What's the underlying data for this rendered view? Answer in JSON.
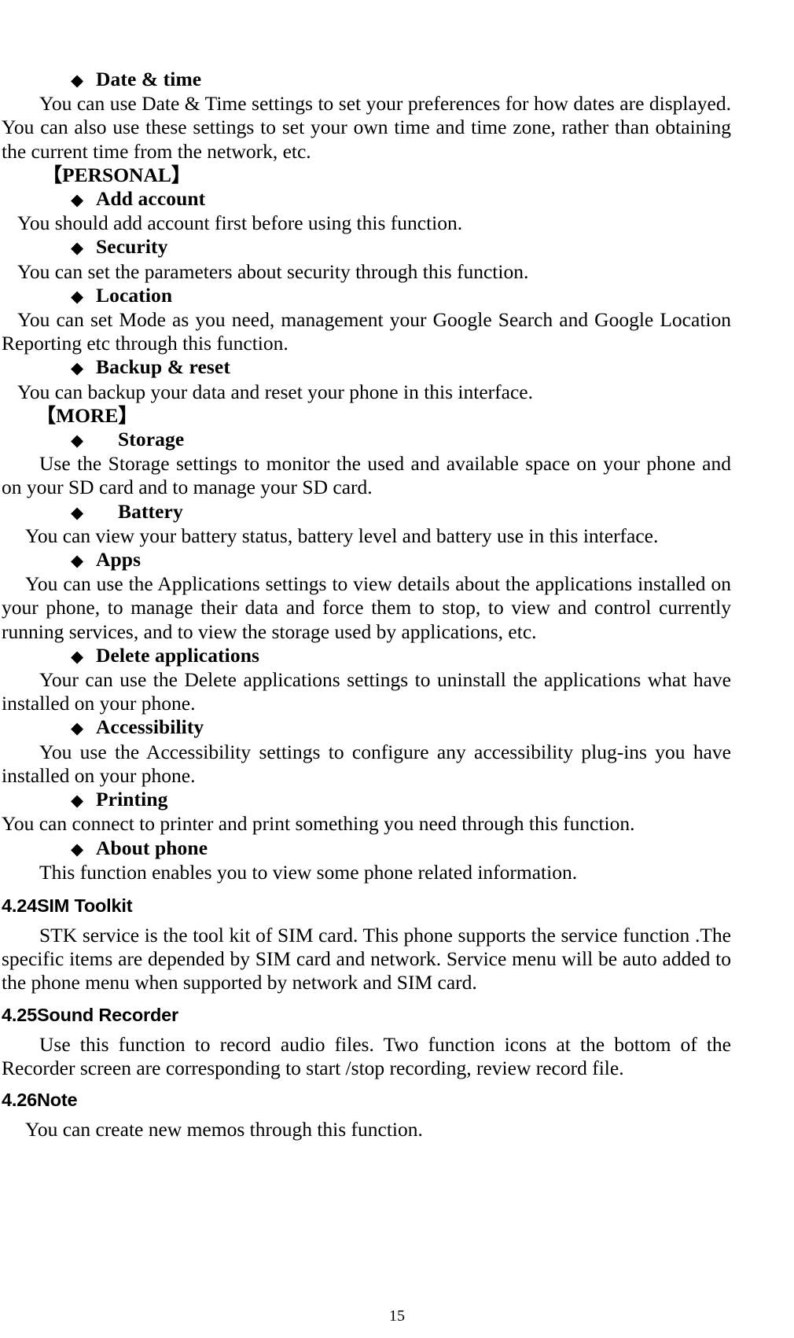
{
  "document": {
    "page_number": "15",
    "bullet_glyph": "◆",
    "bracket_open": "【",
    "bracket_close": "】"
  },
  "blocks": {
    "date_time": {
      "bullet": "Date & time",
      "body": "You can use Date & Time settings to set your preferences for how dates are displayed. You can also use these settings to set your own time and time zone, rather than obtaining the current time from the network, etc."
    },
    "personal_group": {
      "label": "PERSONAL"
    },
    "add_account": {
      "bullet": "Add account",
      "body": "You should add account first before using this function."
    },
    "security": {
      "bullet": "Security",
      "body": "You can set the parameters about security through this function."
    },
    "location": {
      "bullet": "Location",
      "body": "You can set Mode as you need, management your Google Search and Google Location Reporting etc through this function."
    },
    "backup_reset": {
      "bullet": "Backup & reset",
      "body": "You can backup your data and reset your phone in this interface."
    },
    "more_group": {
      "label": "MORE"
    },
    "storage": {
      "bullet": "Storage",
      "body": "Use the Storage settings to monitor the used and available space on your phone and on your SD card and to manage your SD card."
    },
    "battery": {
      "bullet": "Battery",
      "body": "You can view your battery status, battery level and battery use in this interface."
    },
    "apps": {
      "bullet": "Apps",
      "body": "You can use the Applications settings to view details about the applications installed on your phone, to manage their data and force them to stop, to view and control currently running services, and to view the storage used by applications, etc."
    },
    "delete_applications": {
      "bullet": "Delete applications",
      "body": "Your can use the Delete applications settings to uninstall the applications what have installed on your phone."
    },
    "accessibility": {
      "bullet": "Accessibility",
      "body": "You use the Accessibility settings to configure any accessibility plug-ins you have installed on your phone."
    },
    "printing": {
      "bullet": "Printing",
      "body": "You can connect to printer and print something you need through this function."
    },
    "about_phone": {
      "bullet": "About phone",
      "body": "This function enables you to view some phone related information."
    },
    "sim_toolkit": {
      "heading": "4.24SIM Toolkit",
      "body": "STK service is the tool kit of SIM card. This phone supports the service function .The specific items are depended by SIM card and network. Service menu will be auto added to the phone menu when supported by network and SIM card."
    },
    "sound_recorder": {
      "heading": "4.25Sound Recorder",
      "body": "Use this function to record audio files. Two function icons at the bottom of the Recorder screen are corresponding to start /stop recording, review record file."
    },
    "note": {
      "heading": "4.26Note",
      "body": "You can create new memos through this function."
    }
  }
}
